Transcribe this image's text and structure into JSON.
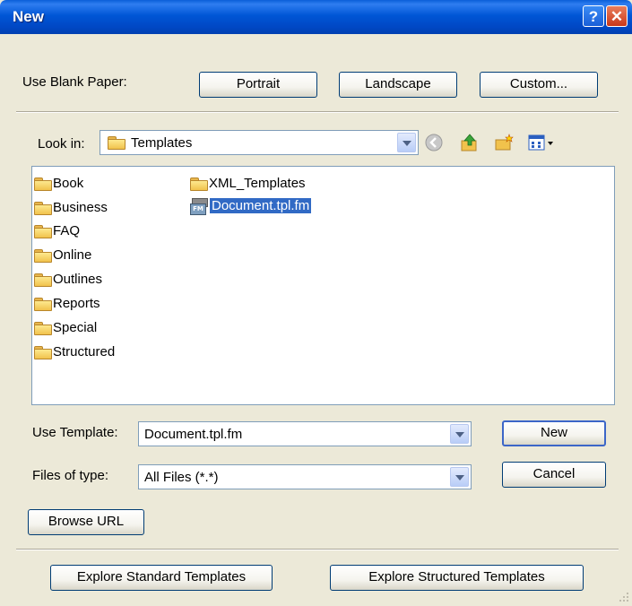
{
  "window": {
    "title": "New",
    "help_label": "?",
    "close_label": "✕"
  },
  "blank_paper": {
    "label": "Use Blank Paper:",
    "portrait": "Portrait",
    "landscape": "Landscape",
    "custom": "Custom..."
  },
  "look_in": {
    "label": "Look in:",
    "value": "Templates"
  },
  "toolbar_icons": [
    "back-icon",
    "up-folder-icon",
    "new-folder-icon",
    "view-menu-icon"
  ],
  "files": {
    "column1": [
      "Book",
      "Business",
      "FAQ",
      "Online",
      "Outlines",
      "Reports",
      "Special",
      "Structured"
    ],
    "column2_folder": "XML_Templates",
    "column2_file": "Document.tpl.fm",
    "file_badge": "FM"
  },
  "use_template": {
    "label": "Use Template:",
    "value": "Document.tpl.fm"
  },
  "files_of_type": {
    "label": "Files of type:",
    "value": "All Files (*.*)"
  },
  "buttons": {
    "new": "New",
    "cancel": "Cancel",
    "browse_url": "Browse URL",
    "explore_standard": "Explore Standard Templates",
    "explore_structured": "Explore Structured Templates"
  },
  "colors": {
    "title_bar": "#0054e3",
    "selection": "#316ac5",
    "dialog_bg": "#ece9d8"
  }
}
